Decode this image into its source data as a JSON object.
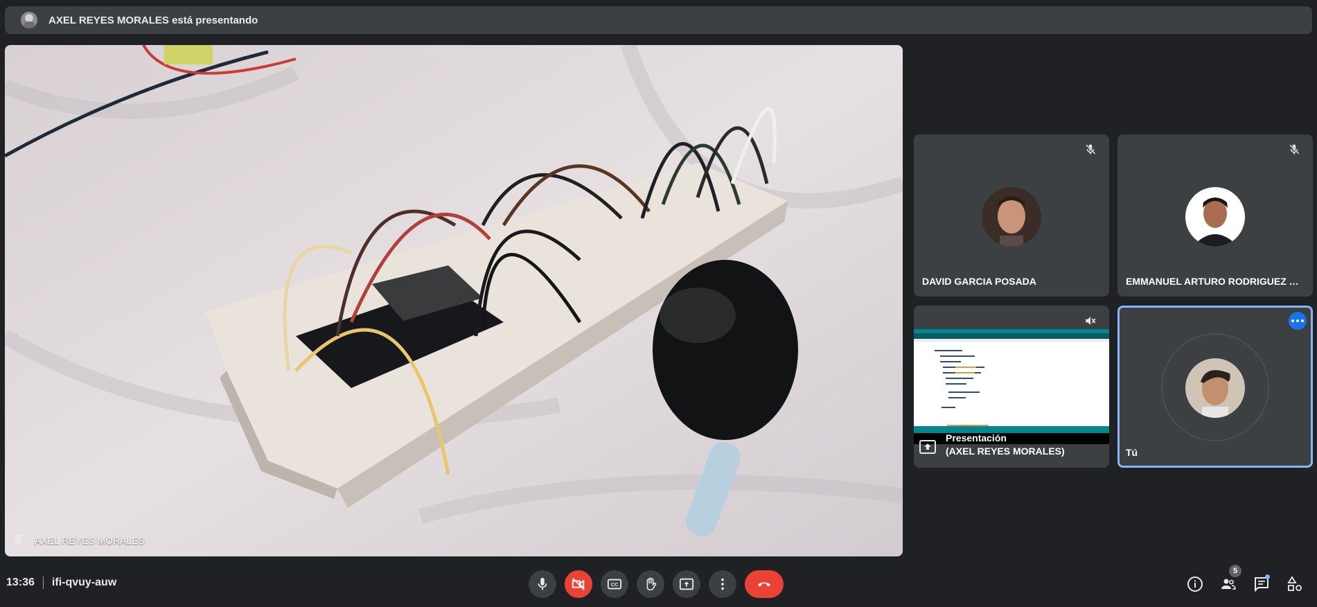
{
  "banner": {
    "text": "AXEL REYES MORALES está presentando"
  },
  "main": {
    "presenter_name": "AXEL REYES MORALES"
  },
  "participants": [
    {
      "name": "DAVID GARCIA POSADA",
      "muted": true
    },
    {
      "name": "EMMANUEL ARTURO RODRIGUEZ MA...",
      "muted": true
    },
    {
      "name_line1": "Presentación",
      "name_line2": "(AXEL REYES MORALES)",
      "audio_muted": true
    },
    {
      "name": "Tú"
    }
  ],
  "bottom": {
    "time": "13:36",
    "meeting_code": "ifi-qvuy-auw",
    "people_count": "5"
  },
  "colors": {
    "background": "#202124",
    "tile": "#3c4043",
    "red": "#ea4335",
    "accent": "#8ab4f8",
    "blue": "#1a73e8"
  },
  "icons": [
    "microphone-icon",
    "camera-off-icon",
    "captions-icon",
    "raise-hand-icon",
    "present-icon",
    "more-options-icon",
    "end-call-icon",
    "info-icon",
    "people-icon",
    "chat-icon",
    "activities-icon"
  ]
}
